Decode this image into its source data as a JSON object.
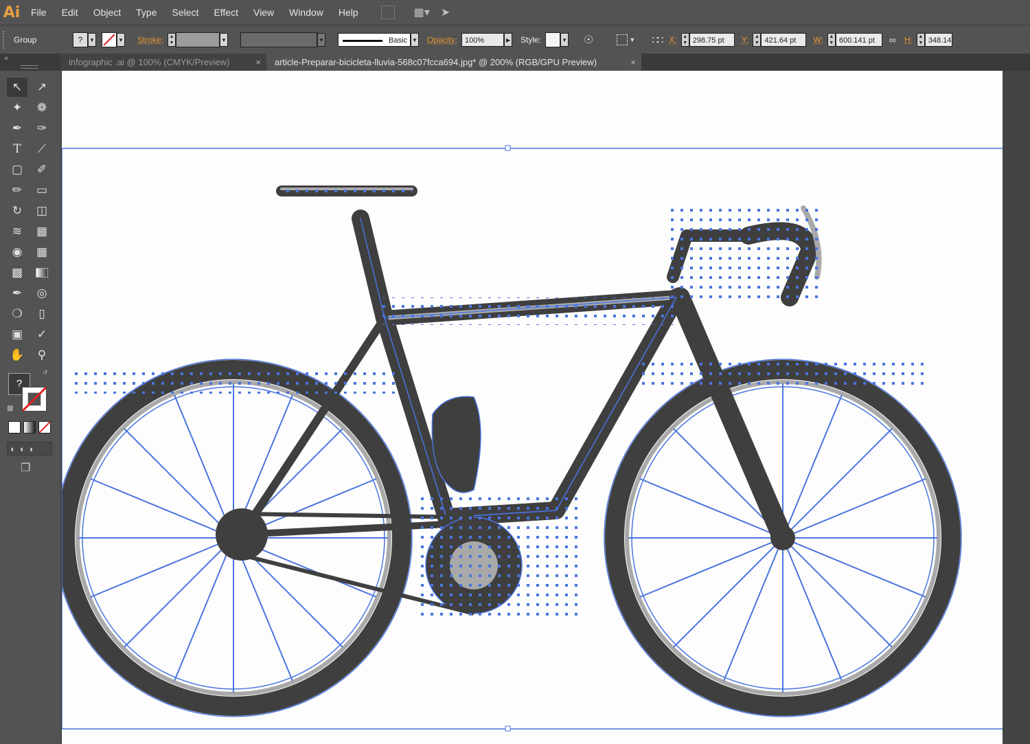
{
  "app": {
    "logo": "Ai"
  },
  "menu": [
    "File",
    "Edit",
    "Object",
    "Type",
    "Select",
    "Effect",
    "View",
    "Window",
    "Help"
  ],
  "control": {
    "selection": "Group",
    "stroke_label": "Stroke:",
    "brush": "Basic",
    "opacity_label": "Opacity:",
    "opacity_value": "100%",
    "style_label": "Style:",
    "x_label": "X:",
    "x_value": "298.75 pt",
    "y_label": "Y:",
    "y_value": "421.64 pt",
    "w_label": "W:",
    "w_value": "600.141 pt",
    "h_label": "H:",
    "h_value": "348.14"
  },
  "tabs": [
    {
      "label": "infographic .ai @ 100% (CMYK/Preview)"
    },
    {
      "label": "article-Preparar-bicicleta-lluvia-568c07fcca694.jpg* @ 200% (RGB/GPU Preview)"
    }
  ],
  "toolbar": {
    "unknown_swatch": "?"
  },
  "colors": {
    "accent": "#e8952e",
    "selection": "#4a74e0",
    "bike_dark": "#3f3f3f",
    "bike_light": "#a9a9a9"
  }
}
